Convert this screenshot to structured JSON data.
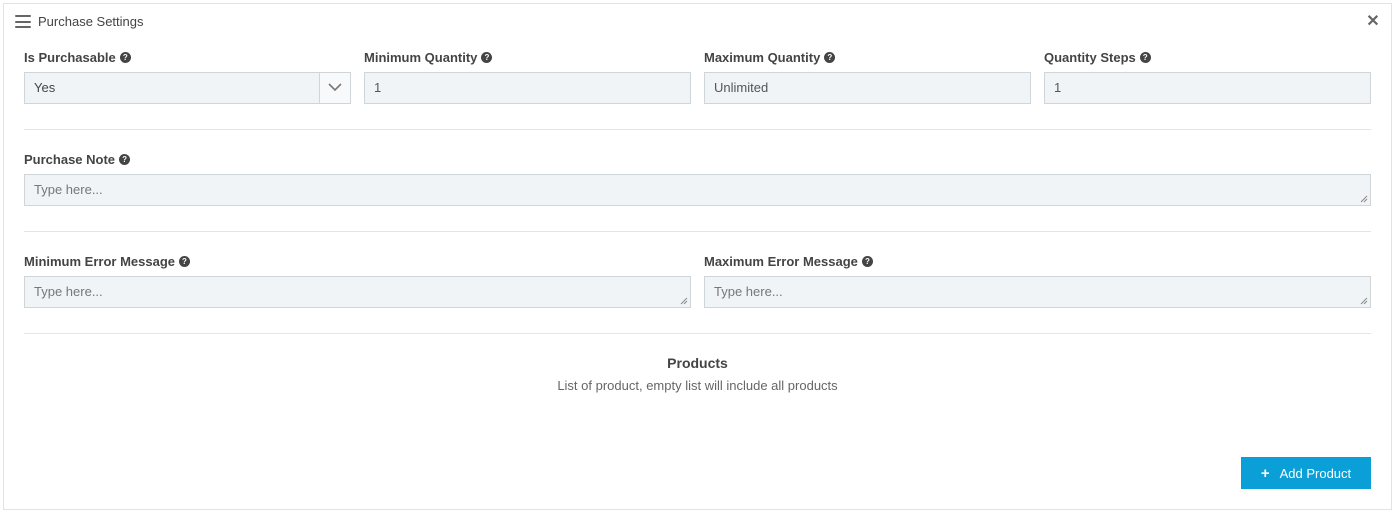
{
  "panel": {
    "title": "Purchase Settings"
  },
  "fields": {
    "is_purchasable": {
      "label": "Is Purchasable",
      "value": "Yes"
    },
    "minimum_quantity": {
      "label": "Minimum Quantity",
      "value": "1"
    },
    "maximum_quantity": {
      "label": "Maximum Quantity",
      "value": "Unlimited"
    },
    "quantity_steps": {
      "label": "Quantity Steps",
      "value": "1"
    },
    "purchase_note": {
      "label": "Purchase Note",
      "placeholder": "Type here..."
    },
    "minimum_error_message": {
      "label": "Minimum Error Message",
      "placeholder": "Type here..."
    },
    "maximum_error_message": {
      "label": "Maximum Error Message",
      "placeholder": "Type here..."
    }
  },
  "products": {
    "title": "Products",
    "subtitle": "List of product, empty list will include all products",
    "add_button_label": "Add Product"
  },
  "colors": {
    "accent": "#0a9fd6",
    "field_bg": "#f0f4f6"
  }
}
